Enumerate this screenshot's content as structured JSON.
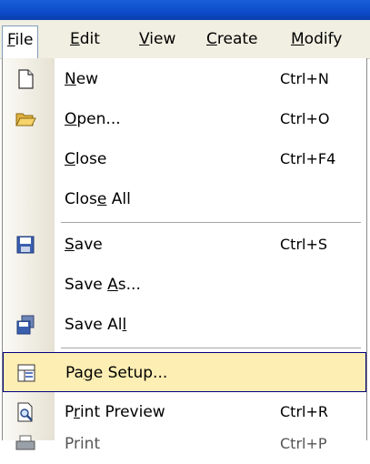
{
  "menubar": {
    "items": [
      {
        "pre": "",
        "u": "F",
        "post": "ile"
      },
      {
        "pre": "",
        "u": "E",
        "post": "dit"
      },
      {
        "pre": "",
        "u": "V",
        "post": "iew"
      },
      {
        "pre": "",
        "u": "C",
        "post": "reate"
      },
      {
        "pre": "",
        "u": "M",
        "post": "odify"
      }
    ],
    "active_index": 0
  },
  "file_menu": {
    "items": [
      {
        "pre": "",
        "u": "N",
        "post": "ew",
        "shortcut": "Ctrl+N",
        "icon": "new-document-icon"
      },
      {
        "pre": "",
        "u": "O",
        "post": "pen...",
        "shortcut": "Ctrl+O",
        "icon": "open-folder-icon"
      },
      {
        "pre": "",
        "u": "C",
        "post": "lose",
        "shortcut": "Ctrl+F4",
        "icon": ""
      },
      {
        "pre": "Clos",
        "u": "e",
        "post": " All",
        "shortcut": "",
        "icon": ""
      },
      {
        "pre": "",
        "u": "S",
        "post": "ave",
        "shortcut": "Ctrl+S",
        "icon": "save-disk-icon"
      },
      {
        "pre": "Save ",
        "u": "A",
        "post": "s...",
        "shortcut": "",
        "icon": ""
      },
      {
        "pre": "Save Al",
        "u": "l",
        "post": "",
        "shortcut": "",
        "icon": "save-all-icon"
      },
      {
        "pre": "Pa",
        "u": "g",
        "post": "e Setup...",
        "shortcut": "",
        "icon": "page-setup-icon"
      },
      {
        "pre": "P",
        "u": "r",
        "post": "int Preview",
        "shortcut": "Ctrl+R",
        "icon": "print-preview-icon"
      },
      {
        "pre": "Print",
        "u": "",
        "post": "",
        "shortcut": "Ctrl+P",
        "icon": "printer-icon"
      }
    ],
    "highlighted_index": 7
  },
  "colors": {
    "titlebar": "#0d4bc9",
    "menubar": "#f1efe2",
    "highlight_fill": "#fdeeb4",
    "highlight_border": "#000080"
  }
}
